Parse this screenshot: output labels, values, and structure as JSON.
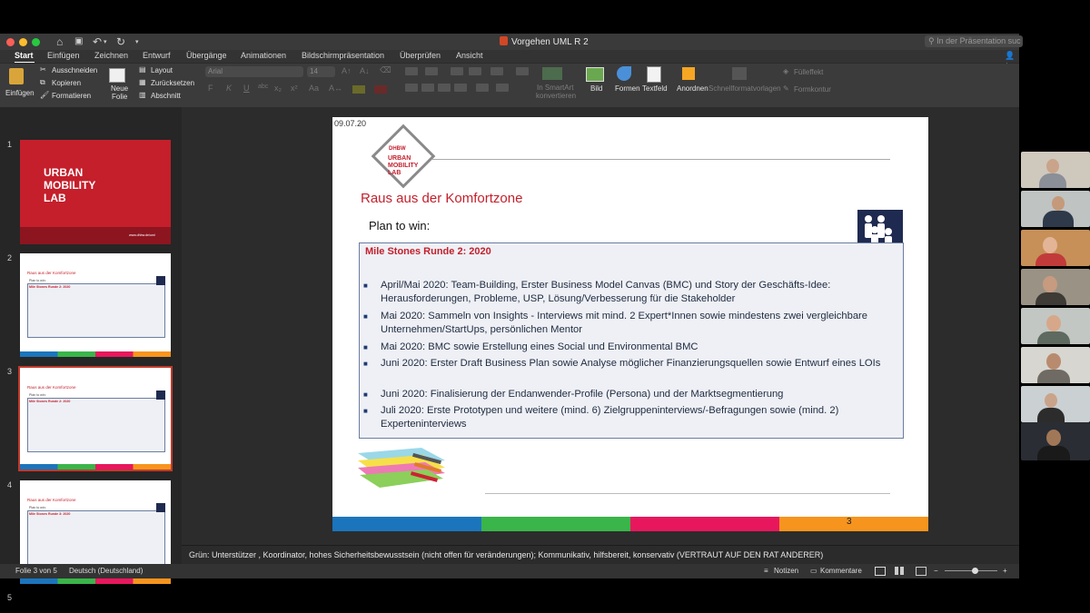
{
  "window": {
    "doc_title": "Vorgehen UML R 2",
    "search_placeholder": "In der Präsentation suc"
  },
  "ribbon_tabs": [
    "Start",
    "Einfügen",
    "Zeichnen",
    "Entwurf",
    "Übergänge",
    "Animationen",
    "Bildschirmpräsentation",
    "Überprüfen",
    "Ansicht"
  ],
  "ribbon": {
    "paste": "Einfügen",
    "cut": "Ausschneiden",
    "copy": "Kopieren",
    "format": "Formatieren",
    "new_slide_1": "Neue",
    "new_slide_2": "Folie",
    "layout": "Layout",
    "reset": "Zurücksetzen",
    "section": "Abschnitt",
    "font_name": "Arial",
    "font_size": "14",
    "smartart_1": "In SmartArt",
    "smartart_2": "konvertieren",
    "picture": "Bild",
    "shapes": "Formen",
    "textbox": "Textfeld",
    "arrange": "Anordnen",
    "quick_styles": "Schnellformatvorlagen",
    "fill_effect": "Fülleffekt",
    "shape_outline": "Formkontur"
  },
  "thumbnails": {
    "numbers": [
      "1",
      "2",
      "3",
      "4",
      "5"
    ],
    "t1_logo": [
      "URBAN",
      "MOBILITY",
      "LAB"
    ],
    "t1_url": "www.dhbw.de/uml",
    "t_title": "Raus aus der Komfortzone",
    "t_plan": "Plan to win:",
    "t2_box": "Mile Stones Runde 2: 2020",
    "t4_box": "Mile Stones Runde 3: 2020"
  },
  "slide": {
    "date": "09.07.20",
    "logo_brand": "DHBW",
    "logo_lines": [
      "URBAN",
      "MOBILITY",
      "LAB"
    ],
    "title": "Raus aus der Komfortzone",
    "plan": "Plan to win:",
    "box_title": "Mile Stones Runde 2: 2020",
    "bullets": [
      "April/Mai 2020: Team-Building, Erster Business Model Canvas (BMC) und Story der Geschäfts-Idee: Herausforderungen, Probleme, USP, Lösung/Verbesserung für die Stakeholder",
      "Mai 2020: Sammeln von Insights - Interviews mit mind. 2 Expert*Innen sowie mindestens zwei vergleichbare Unternehmen/StartUps, persönlichen Mentor",
      "Mai 2020: BMC sowie Erstellung eines Social und Environmental BMC",
      "Juni 2020: Erster Draft Business Plan sowie Analyse möglicher Finanzierungsquellen sowie Entwurf eines LOIs",
      "Juni 2020: Finalisierung der Endanwender-Profile (Persona) und der Marktsegmentierung",
      "Juli 2020: Erste Prototypen und weitere (mind. 6) Zielgruppeninterviews/-Befragungen sowie (mind. 2) Experteninterviews"
    ],
    "page_number": "3",
    "footer_colors": [
      "#1b75bc",
      "#3ab54a",
      "#e8175d",
      "#f7941d"
    ]
  },
  "notes": "Grün: Unterstützer , Koordinator, hohes Sicherheitsbewusstsein (nicht offen für veränderungen); Kommunikativ, hilfsbereit, konservativ (VERTRAUT AUF DEN RAT ANDERER)",
  "status": {
    "slide_of": "Folie 3 von 5",
    "language": "Deutsch (Deutschland)",
    "notes_btn": "Notizen",
    "comments_btn": "Kommentare"
  },
  "colors": {
    "accent_red": "#c41f2b",
    "app_dark": "#2b2b2b"
  }
}
